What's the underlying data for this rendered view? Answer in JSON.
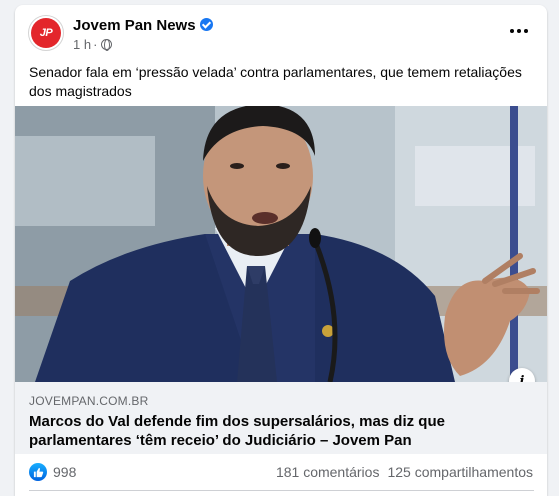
{
  "post": {
    "page_name": "Jovem Pan News",
    "avatar_text": "JP",
    "time": "1 h",
    "separator": "·",
    "text": "Senador fala em ‘pressão velada’ contra parlamentares, que temem retaliações dos magistrados"
  },
  "link": {
    "domain": "JOVEMPAN.COM.BR",
    "title": "Marcos do Val defende fim dos supersalários, mas diz que parlamentares ‘têm receio’ do Judiciário – Jovem Pan"
  },
  "stats": {
    "likes": "998",
    "comments": "181 comentários",
    "shares": "125 compartilhamentos"
  },
  "colors": {
    "brand_red": "#e3262b",
    "facebook_blue": "#1877f2",
    "secondary_text": "#65676b"
  },
  "icons": {
    "more": "more-horizontal-icon",
    "privacy": "globe-icon",
    "verified": "verified-badge-icon",
    "info": "info-icon",
    "like": "like-reaction-icon"
  }
}
